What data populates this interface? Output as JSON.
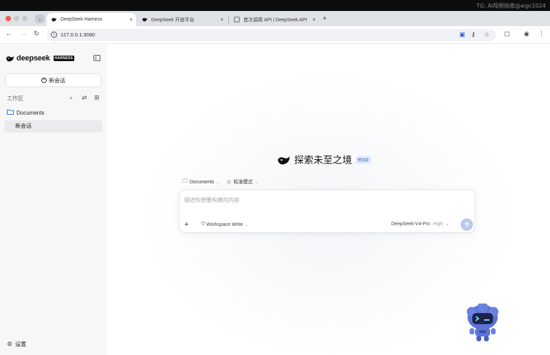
{
  "watermark": "TG: AI视频指南@aigc1024",
  "browser": {
    "tabs": [
      {
        "title": "DeepSeek Harness",
        "active": true
      },
      {
        "title": "DeepSeek 开放平台",
        "active": false
      },
      {
        "title": "首次调用 API | DeepSeek API",
        "active": false
      }
    ],
    "close_glyph": "×",
    "new_tab_glyph": "+",
    "url": "127.0.0.1:3080"
  },
  "sidebar": {
    "brand": "deepseek",
    "badge": "HARNESS",
    "new_chat_label": "新会话",
    "workspace_label": "工作区",
    "folder_label": "Documents",
    "chat_items": [
      "新会话"
    ],
    "settings_label": "设置"
  },
  "main": {
    "hero_title": "探索未至之境",
    "beta_badge": "预览版",
    "workspace_selector": "Documents",
    "mode_selector": "标准模式",
    "input_placeholder": "描述你想要构建的内容",
    "permission_label": "Workspace Write",
    "model_label": "DeepSeek-V4-Pro",
    "effort_label": "High"
  },
  "colors": {
    "accent": "#3b63c4",
    "send_button": "#b9c9ee",
    "folder": "#3a6fd8"
  }
}
